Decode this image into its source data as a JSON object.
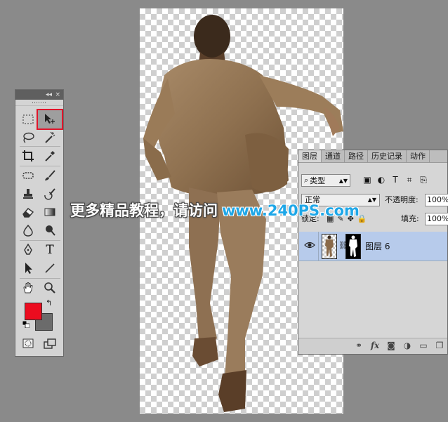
{
  "colors": {
    "foreground": "#ec0c1f",
    "background": "#6b6b6b",
    "selection_outline": "#e0152b",
    "watermark_url": "#1ea7e8",
    "layer_selected": "#b7cbeb"
  },
  "tools_panel": {
    "collapse_glyph": "◂◂",
    "close_glyph": "×",
    "tools": [
      {
        "name": "rectangular-marquee-icon",
        "selected": false
      },
      {
        "name": "move-tool-icon",
        "selected": true
      },
      {
        "name": "lasso-icon",
        "selected": false
      },
      {
        "name": "magic-wand-icon",
        "selected": false
      },
      {
        "name": "crop-icon",
        "selected": false
      },
      {
        "name": "eyedropper-icon",
        "selected": false
      },
      {
        "name": "spot-healing-icon",
        "selected": false
      },
      {
        "name": "brush-icon",
        "selected": false
      },
      {
        "name": "clone-stamp-icon",
        "selected": false
      },
      {
        "name": "history-brush-icon",
        "selected": false
      },
      {
        "name": "eraser-icon",
        "selected": false
      },
      {
        "name": "gradient-icon",
        "selected": false
      },
      {
        "name": "blur-icon",
        "selected": false
      },
      {
        "name": "dodge-icon",
        "selected": false
      },
      {
        "name": "pen-icon",
        "selected": false
      },
      {
        "name": "type-icon",
        "selected": false
      },
      {
        "name": "path-selection-icon",
        "selected": false
      },
      {
        "name": "line-icon",
        "selected": false
      },
      {
        "name": "hand-icon",
        "selected": false
      },
      {
        "name": "zoom-icon",
        "selected": false
      },
      {
        "name": "quick-mask-icon",
        "selected": false
      },
      {
        "name": "screen-mode-icon",
        "selected": false
      }
    ],
    "type_glyph": "T"
  },
  "layers_panel": {
    "tabs": [
      "图层",
      "通道",
      "路径",
      "历史记录",
      "动作"
    ],
    "filter_kind": "类型",
    "blend_mode": "正常",
    "opacity_label": "不透明度:",
    "opacity_value": "100%",
    "lock_label": "锁定:",
    "fill_label": "填充:",
    "fill_value": "100%",
    "layers": [
      {
        "name": "图层 6",
        "visible": true,
        "has_mask": true,
        "selected": true
      }
    ],
    "bottom_icons": [
      "link-icon",
      "fx-icon",
      "mask-icon",
      "adjustment-icon",
      "group-icon",
      "new-layer-icon"
    ],
    "fx_label": "fx"
  },
  "watermark": {
    "text": "更多精品教程，请访问",
    "url": "www.240PS.com"
  }
}
